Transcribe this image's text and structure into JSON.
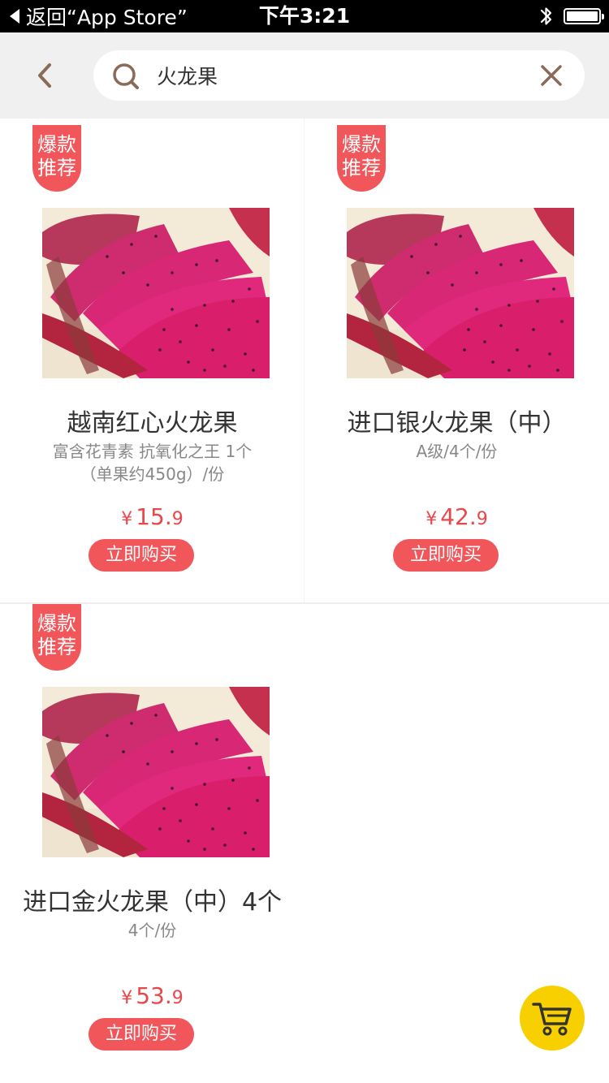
{
  "status_bar": {
    "back_text": "返回“App Store”",
    "time": "下午3:21"
  },
  "search": {
    "query": "火龙果",
    "placeholder": ""
  },
  "products": [
    {
      "badge_line1": "爆款",
      "badge_line2": "推荐",
      "name": "越南红心火龙果",
      "desc": "富含花青素 抗氧化之王 1个 （单果约450g）/份",
      "currency": "¥",
      "price_int": "15.",
      "price_dec": "9",
      "buy_label": "立即购买"
    },
    {
      "badge_line1": "爆款",
      "badge_line2": "推荐",
      "name": "进口银火龙果（中）",
      "desc": "A级/4个/份",
      "currency": "¥",
      "price_int": "42.",
      "price_dec": "9",
      "buy_label": "立即购买"
    },
    {
      "badge_line1": "爆款",
      "badge_line2": "推荐",
      "name": "进口金火龙果（中）4个",
      "desc": "4个/份",
      "currency": "¥",
      "price_int": "53.",
      "price_dec": "9",
      "buy_label": "立即购买"
    }
  ],
  "colors": {
    "accent": "#f0565a",
    "price": "#e8474b",
    "cart": "#f8d000",
    "header_bg": "#f0f0f0"
  },
  "icons": {
    "back": "chevron-left-icon",
    "search": "search-icon",
    "clear": "close-icon",
    "cart": "cart-icon"
  }
}
